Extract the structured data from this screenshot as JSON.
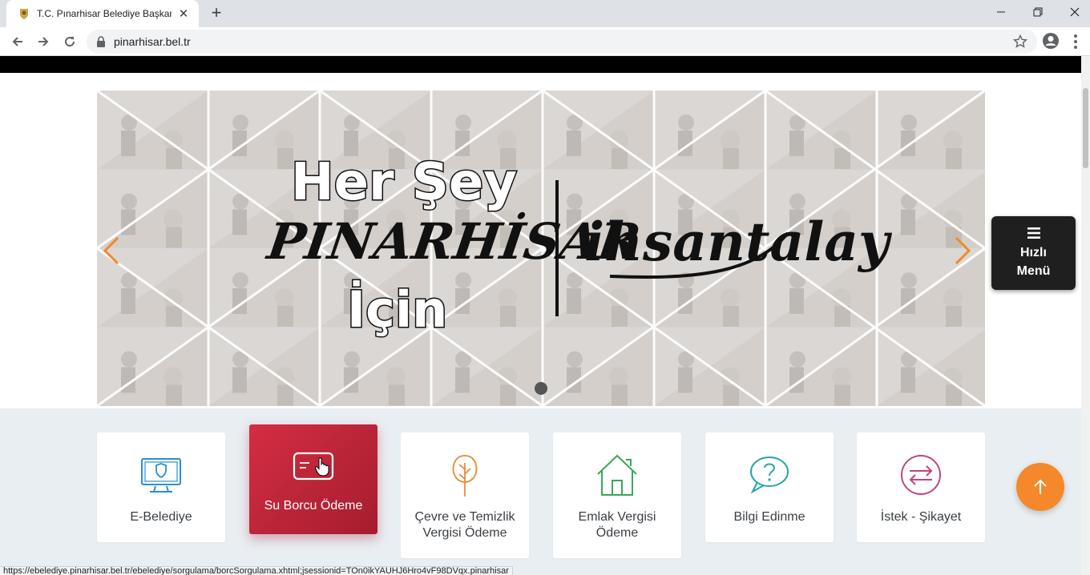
{
  "browser": {
    "tab_title": "T.C. Pınarhisar Belediye Başkanlığı",
    "url": "pinarhisar.bel.tr",
    "status_url": "https://ebelediye.pinarhisar.bel.tr/ebelediye/sorgulama/borcSorgulama.xhtml;jsessionid=TOn0ikYAUHJ6Hro4vF98DVqx.pinarhisar"
  },
  "slider": {
    "line1": "Her Şey",
    "line2": "PINARHİSAR",
    "line3": "İçin",
    "signature": "ihsantalay"
  },
  "quick_menu": {
    "line1": "Hızlı",
    "line2": "Menü"
  },
  "services": [
    {
      "label": "E-Belediye",
      "icon": "monitor-shield-icon",
      "color": "#2a8fd0"
    },
    {
      "label": "Su Borcu Ödeme",
      "icon": "credit-card-icon",
      "color": "#ffffff"
    },
    {
      "label": "Çevre ve Temizlik Vergisi Ödeme",
      "icon": "tree-icon",
      "color": "#e88a3a"
    },
    {
      "label": "Emlak Vergisi Ödeme",
      "icon": "house-icon",
      "color": "#3aa858"
    },
    {
      "label": "Bilgi Edinme",
      "icon": "question-bubble-icon",
      "color": "#2aa3a8"
    },
    {
      "label": "İstek - Şikayet",
      "icon": "exchange-arrows-icon",
      "color": "#c2457c"
    }
  ],
  "colors": {
    "accent_red": "#c8273b",
    "scroll_top": "#f5882b"
  }
}
